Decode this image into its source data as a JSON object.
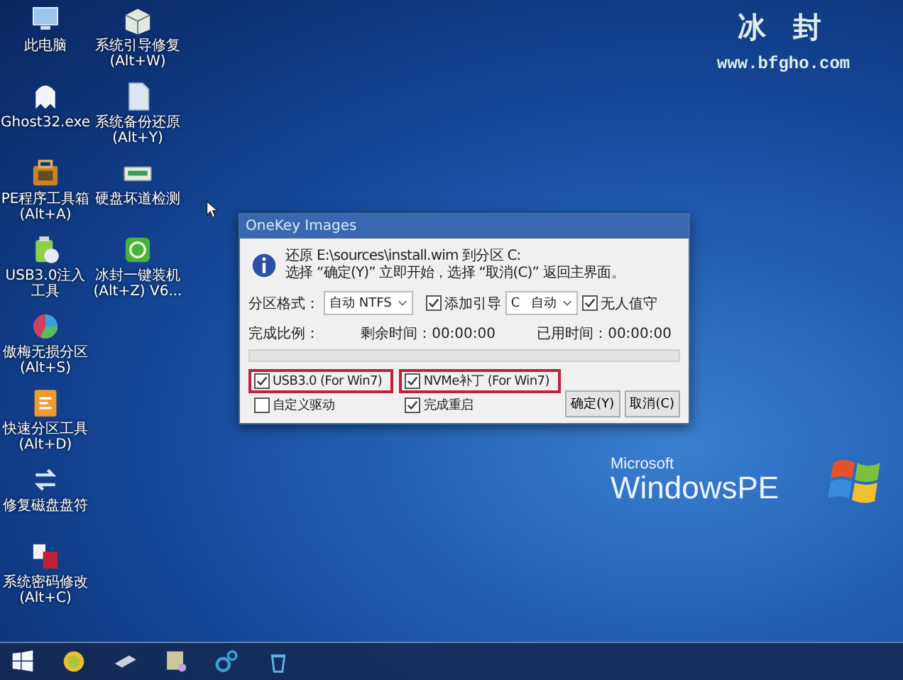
{
  "desktop_icons": [
    {
      "kind": "monitor",
      "lines": [
        "此电脑"
      ]
    },
    {
      "kind": "ghost",
      "lines": [
        "Ghost32.exe"
      ]
    },
    {
      "kind": "toolbox",
      "lines": [
        "PE程序工具箱",
        "(Alt+A)"
      ]
    },
    {
      "kind": "usb",
      "lines": [
        "USB3.0注入",
        "工具"
      ]
    },
    {
      "kind": "pie",
      "lines": [
        "傲梅无损分区",
        "(Alt+S)"
      ]
    },
    {
      "kind": "orange",
      "lines": [
        "快速分区工具",
        "(Alt+D)"
      ]
    },
    {
      "kind": "arrows",
      "lines": [
        "修复磁盘盘符"
      ]
    },
    {
      "kind": "key",
      "lines": [
        "系统密码修改",
        "(Alt+C)"
      ]
    },
    {
      "kind": "package",
      "lines": [
        "系统引导修复",
        "(Alt+W)"
      ]
    },
    {
      "kind": "document",
      "lines": [
        "系统备份还原",
        "(Alt+Y)"
      ]
    },
    {
      "kind": "disk",
      "lines": [
        "硬盘坏道检测"
      ]
    },
    {
      "kind": "green",
      "lines": [
        "冰封一键装机",
        "(Alt+Z) V6..."
      ]
    }
  ],
  "branding": {
    "name": "冰 封",
    "site": "www.bfgho.com",
    "vendor": "Microsoft",
    "product": "WindowsPE"
  },
  "dialog": {
    "title": "OneKey Images",
    "message": [
      "还原 E:\\sources\\install.wim 到分区 C:",
      "选择 “确定(Y)” 立即开始，选择 “取消(C)” 返回主界面。"
    ],
    "format": {
      "label": "分区格式：",
      "value": "自动 NTFS"
    },
    "add_boot": {
      "label": "添加引导",
      "checked": true,
      "drive": "C",
      "mode": "自动"
    },
    "unattended": {
      "label": "无人值守",
      "checked": true
    },
    "progress": {
      "label": "完成比例：",
      "level": 0
    },
    "remaining": {
      "label": "剩余时间：",
      "value": "00:00:00"
    },
    "elapsed": {
      "label": "已用时间：",
      "value": "00:00:00"
    },
    "options": [
      {
        "label": "USB3.0 (For Win7)",
        "checked": true,
        "highlighted": true
      },
      {
        "label": "NVMe补丁 (For Win7)",
        "checked": true,
        "highlighted": true
      },
      {
        "label": "自定义驱动",
        "checked": false,
        "highlighted": false
      },
      {
        "label": "完成重启",
        "checked": true,
        "highlighted": false
      }
    ],
    "buttons": [
      "确定(Y)",
      "取消(C)"
    ]
  },
  "taskbar": [
    {
      "kind": "start"
    },
    {
      "kind": "sun"
    },
    {
      "kind": "drive"
    },
    {
      "kind": "explorer"
    },
    {
      "kind": "gears"
    },
    {
      "kind": "recycle"
    }
  ]
}
